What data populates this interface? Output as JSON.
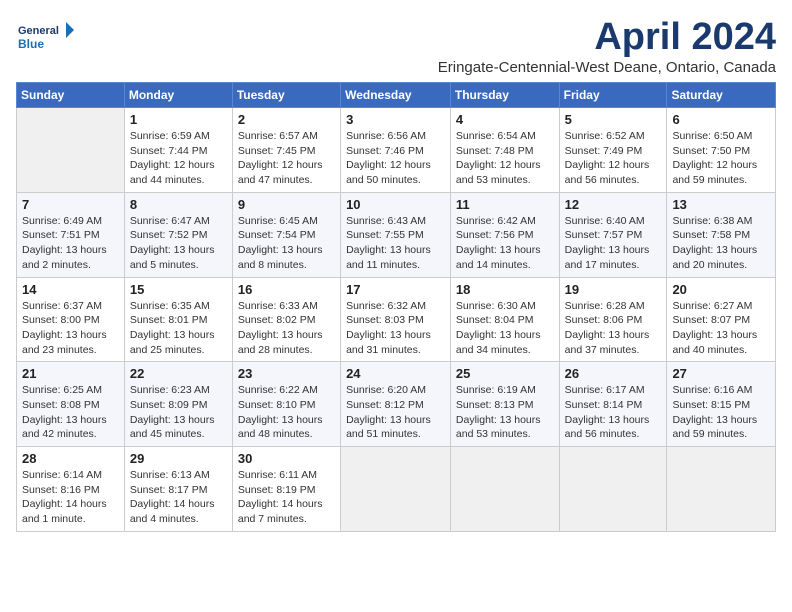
{
  "header": {
    "logo_line1": "General",
    "logo_line2": "Blue",
    "title": "April 2024",
    "subtitle": "Eringate-Centennial-West Deane, Ontario, Canada"
  },
  "days_of_week": [
    "Sunday",
    "Monday",
    "Tuesday",
    "Wednesday",
    "Thursday",
    "Friday",
    "Saturday"
  ],
  "weeks": [
    [
      {
        "day": "",
        "info": ""
      },
      {
        "day": "1",
        "info": "Sunrise: 6:59 AM\nSunset: 7:44 PM\nDaylight: 12 hours\nand 44 minutes."
      },
      {
        "day": "2",
        "info": "Sunrise: 6:57 AM\nSunset: 7:45 PM\nDaylight: 12 hours\nand 47 minutes."
      },
      {
        "day": "3",
        "info": "Sunrise: 6:56 AM\nSunset: 7:46 PM\nDaylight: 12 hours\nand 50 minutes."
      },
      {
        "day": "4",
        "info": "Sunrise: 6:54 AM\nSunset: 7:48 PM\nDaylight: 12 hours\nand 53 minutes."
      },
      {
        "day": "5",
        "info": "Sunrise: 6:52 AM\nSunset: 7:49 PM\nDaylight: 12 hours\nand 56 minutes."
      },
      {
        "day": "6",
        "info": "Sunrise: 6:50 AM\nSunset: 7:50 PM\nDaylight: 12 hours\nand 59 minutes."
      }
    ],
    [
      {
        "day": "7",
        "info": "Sunrise: 6:49 AM\nSunset: 7:51 PM\nDaylight: 13 hours\nand 2 minutes."
      },
      {
        "day": "8",
        "info": "Sunrise: 6:47 AM\nSunset: 7:52 PM\nDaylight: 13 hours\nand 5 minutes."
      },
      {
        "day": "9",
        "info": "Sunrise: 6:45 AM\nSunset: 7:54 PM\nDaylight: 13 hours\nand 8 minutes."
      },
      {
        "day": "10",
        "info": "Sunrise: 6:43 AM\nSunset: 7:55 PM\nDaylight: 13 hours\nand 11 minutes."
      },
      {
        "day": "11",
        "info": "Sunrise: 6:42 AM\nSunset: 7:56 PM\nDaylight: 13 hours\nand 14 minutes."
      },
      {
        "day": "12",
        "info": "Sunrise: 6:40 AM\nSunset: 7:57 PM\nDaylight: 13 hours\nand 17 minutes."
      },
      {
        "day": "13",
        "info": "Sunrise: 6:38 AM\nSunset: 7:58 PM\nDaylight: 13 hours\nand 20 minutes."
      }
    ],
    [
      {
        "day": "14",
        "info": "Sunrise: 6:37 AM\nSunset: 8:00 PM\nDaylight: 13 hours\nand 23 minutes."
      },
      {
        "day": "15",
        "info": "Sunrise: 6:35 AM\nSunset: 8:01 PM\nDaylight: 13 hours\nand 25 minutes."
      },
      {
        "day": "16",
        "info": "Sunrise: 6:33 AM\nSunset: 8:02 PM\nDaylight: 13 hours\nand 28 minutes."
      },
      {
        "day": "17",
        "info": "Sunrise: 6:32 AM\nSunset: 8:03 PM\nDaylight: 13 hours\nand 31 minutes."
      },
      {
        "day": "18",
        "info": "Sunrise: 6:30 AM\nSunset: 8:04 PM\nDaylight: 13 hours\nand 34 minutes."
      },
      {
        "day": "19",
        "info": "Sunrise: 6:28 AM\nSunset: 8:06 PM\nDaylight: 13 hours\nand 37 minutes."
      },
      {
        "day": "20",
        "info": "Sunrise: 6:27 AM\nSunset: 8:07 PM\nDaylight: 13 hours\nand 40 minutes."
      }
    ],
    [
      {
        "day": "21",
        "info": "Sunrise: 6:25 AM\nSunset: 8:08 PM\nDaylight: 13 hours\nand 42 minutes."
      },
      {
        "day": "22",
        "info": "Sunrise: 6:23 AM\nSunset: 8:09 PM\nDaylight: 13 hours\nand 45 minutes."
      },
      {
        "day": "23",
        "info": "Sunrise: 6:22 AM\nSunset: 8:10 PM\nDaylight: 13 hours\nand 48 minutes."
      },
      {
        "day": "24",
        "info": "Sunrise: 6:20 AM\nSunset: 8:12 PM\nDaylight: 13 hours\nand 51 minutes."
      },
      {
        "day": "25",
        "info": "Sunrise: 6:19 AM\nSunset: 8:13 PM\nDaylight: 13 hours\nand 53 minutes."
      },
      {
        "day": "26",
        "info": "Sunrise: 6:17 AM\nSunset: 8:14 PM\nDaylight: 13 hours\nand 56 minutes."
      },
      {
        "day": "27",
        "info": "Sunrise: 6:16 AM\nSunset: 8:15 PM\nDaylight: 13 hours\nand 59 minutes."
      }
    ],
    [
      {
        "day": "28",
        "info": "Sunrise: 6:14 AM\nSunset: 8:16 PM\nDaylight: 14 hours\nand 1 minute."
      },
      {
        "day": "29",
        "info": "Sunrise: 6:13 AM\nSunset: 8:17 PM\nDaylight: 14 hours\nand 4 minutes."
      },
      {
        "day": "30",
        "info": "Sunrise: 6:11 AM\nSunset: 8:19 PM\nDaylight: 14 hours\nand 7 minutes."
      },
      {
        "day": "",
        "info": ""
      },
      {
        "day": "",
        "info": ""
      },
      {
        "day": "",
        "info": ""
      },
      {
        "day": "",
        "info": ""
      }
    ]
  ]
}
